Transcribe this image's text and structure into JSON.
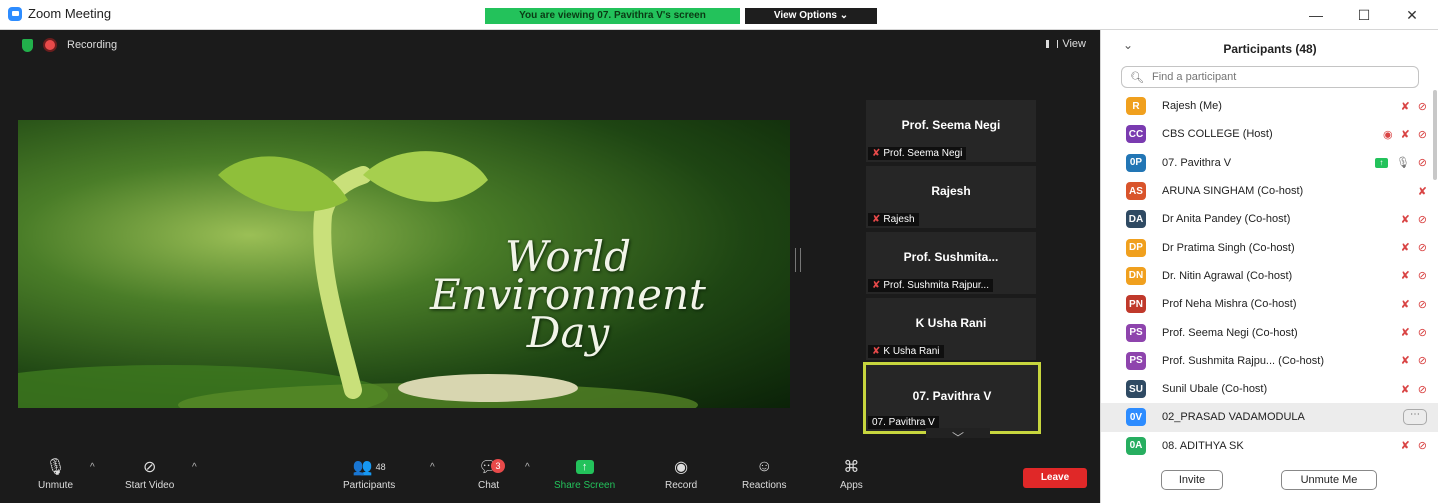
{
  "app": {
    "title": "Zoom Meeting"
  },
  "banner": {
    "viewing": "You are viewing 07. Pavithra V's screen",
    "view_options": "View Options ⌄"
  },
  "window_controls": {
    "minimize": "—",
    "maximize": "☐",
    "close": "✕"
  },
  "stage": {
    "recording": "Recording",
    "view": "View"
  },
  "shared_screen": {
    "line1": "World",
    "line2": "Environment",
    "line3": "Day"
  },
  "tiles": [
    {
      "name": "Prof. Seema Negi",
      "label": "Prof. Seema Negi",
      "muted": true
    },
    {
      "name": "Rajesh",
      "label": "Rajesh",
      "muted": true
    },
    {
      "name": "Prof. Sushmita...",
      "label": "Prof. Sushmita Rajpur...",
      "muted": true
    },
    {
      "name": "K Usha Rani",
      "label": "K Usha Rani",
      "muted": true
    },
    {
      "name": "07. Pavithra V",
      "label": "07. Pavithra V",
      "muted": false
    }
  ],
  "toolbar": {
    "unmute": "Unmute",
    "start_video": "Start Video",
    "participants": "Participants",
    "participants_count": "48",
    "chat": "Chat",
    "chat_badge": "3",
    "share_screen": "Share Screen",
    "record": "Record",
    "reactions": "Reactions",
    "apps": "Apps",
    "leave": "Leave"
  },
  "panel": {
    "title": "Participants (48)",
    "search_placeholder": "Find a participant",
    "invite": "Invite",
    "unmute_me": "Unmute Me",
    "participants": [
      {
        "initials": "R",
        "color": "#f0a01e",
        "name": "Rajesh (Me)",
        "icons": [
          "mic-muted",
          "video-off"
        ]
      },
      {
        "initials": "CC",
        "color": "#7a3bb0",
        "name": "CBS COLLEGE (Host)",
        "icons": [
          "recording",
          "mic-muted",
          "video-off"
        ]
      },
      {
        "initials": "0P",
        "color": "#2276b5",
        "name": "07. Pavithra V",
        "icons": [
          "sharing",
          "mic-on",
          "video-off"
        ]
      },
      {
        "initials": "AS",
        "color": "#d9542b",
        "name": "ARUNA SINGHAM (Co-host)",
        "icons": [
          "mic-muted"
        ]
      },
      {
        "initials": "DA",
        "color": "#2f4a63",
        "name": "Dr Anita Pandey (Co-host)",
        "icons": [
          "mic-muted",
          "video-off"
        ]
      },
      {
        "initials": "DP",
        "color": "#f0a01e",
        "name": "Dr Pratima Singh (Co-host)",
        "icons": [
          "mic-muted",
          "video-off"
        ]
      },
      {
        "initials": "DN",
        "color": "#f0a01e",
        "name": "Dr. Nitin Agrawal (Co-host)",
        "icons": [
          "mic-muted",
          "video-off"
        ]
      },
      {
        "initials": "PN",
        "color": "#c0392b",
        "name": "Prof Neha Mishra (Co-host)",
        "icons": [
          "mic-muted",
          "video-off"
        ]
      },
      {
        "initials": "PS",
        "color": "#8e44ad",
        "name": "Prof. Seema Negi (Co-host)",
        "icons": [
          "mic-muted",
          "video-off"
        ]
      },
      {
        "initials": "PS",
        "color": "#8e44ad",
        "name": "Prof. Sushmita Rajpu...  (Co-host)",
        "icons": [
          "mic-muted",
          "video-off"
        ]
      },
      {
        "initials": "SU",
        "color": "#2f4a63",
        "name": "Sunil Ubale (Co-host)",
        "icons": [
          "mic-muted",
          "video-off"
        ]
      },
      {
        "initials": "0V",
        "color": "#2d8cff",
        "name": "02_PRASAD VADAMODULA",
        "icons": [
          "more"
        ],
        "highlight": true
      },
      {
        "initials": "0A",
        "color": "#27ae60",
        "name": "08. ADITHYA SK",
        "icons": [
          "mic-muted",
          "video-off"
        ]
      }
    ]
  }
}
